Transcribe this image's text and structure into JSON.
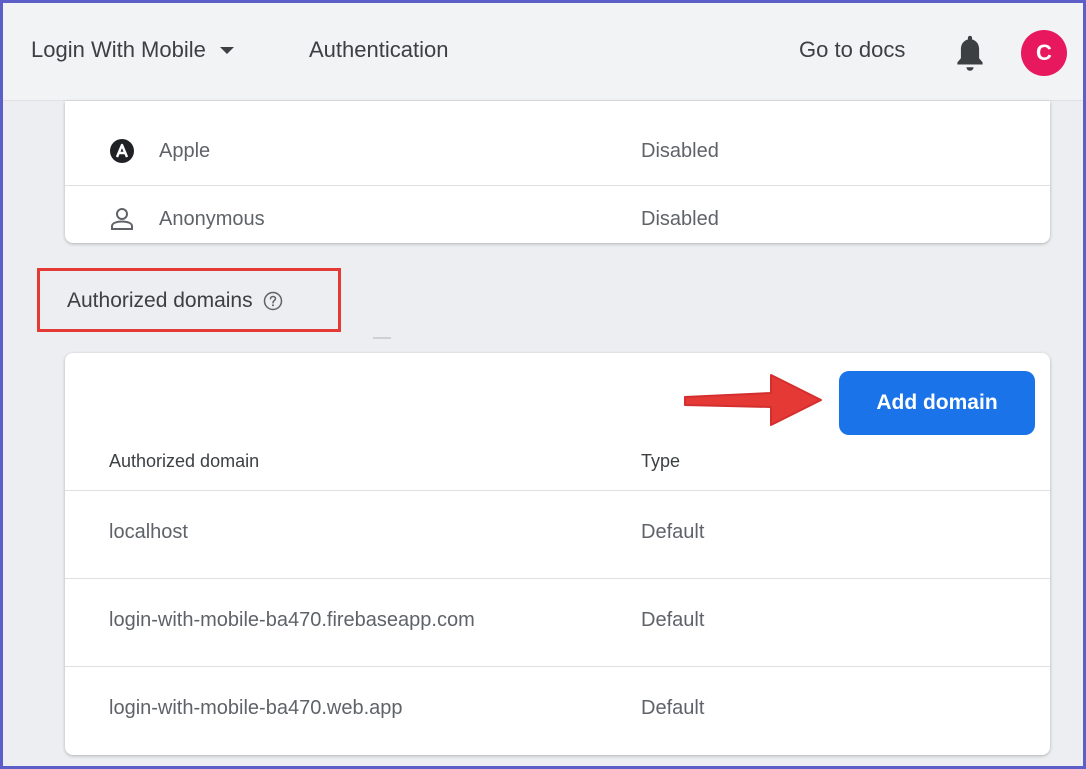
{
  "header": {
    "project_name": "Login With Mobile",
    "section": "Authentication",
    "docs_label": "Go to docs",
    "avatar_letter": "C",
    "avatar_color": "#e8185f",
    "icons": [
      "caret-down-icon",
      "bell-icon"
    ]
  },
  "providers": [
    {
      "name": "Apple",
      "status": "Disabled",
      "icon": "apple-logo-icon"
    },
    {
      "name": "Anonymous",
      "status": "Disabled",
      "icon": "person-icon"
    }
  ],
  "authorized_domains": {
    "heading": "Authorized domains",
    "help_icon": "help-circle-icon",
    "add_button": "Add domain",
    "columns": [
      "Authorized domain",
      "Type"
    ],
    "rows": [
      {
        "domain": "localhost",
        "type": "Default"
      },
      {
        "domain": "login-with-mobile-ba470.firebaseapp.com",
        "type": "Default"
      },
      {
        "domain": "login-with-mobile-ba470.web.app",
        "type": "Default"
      }
    ]
  },
  "annotations": {
    "highlight_color": "#e53935",
    "arrow_color": "#e53935"
  },
  "colors": {
    "primary": "#1a73e8",
    "frame_border": "#5b5fc7"
  }
}
